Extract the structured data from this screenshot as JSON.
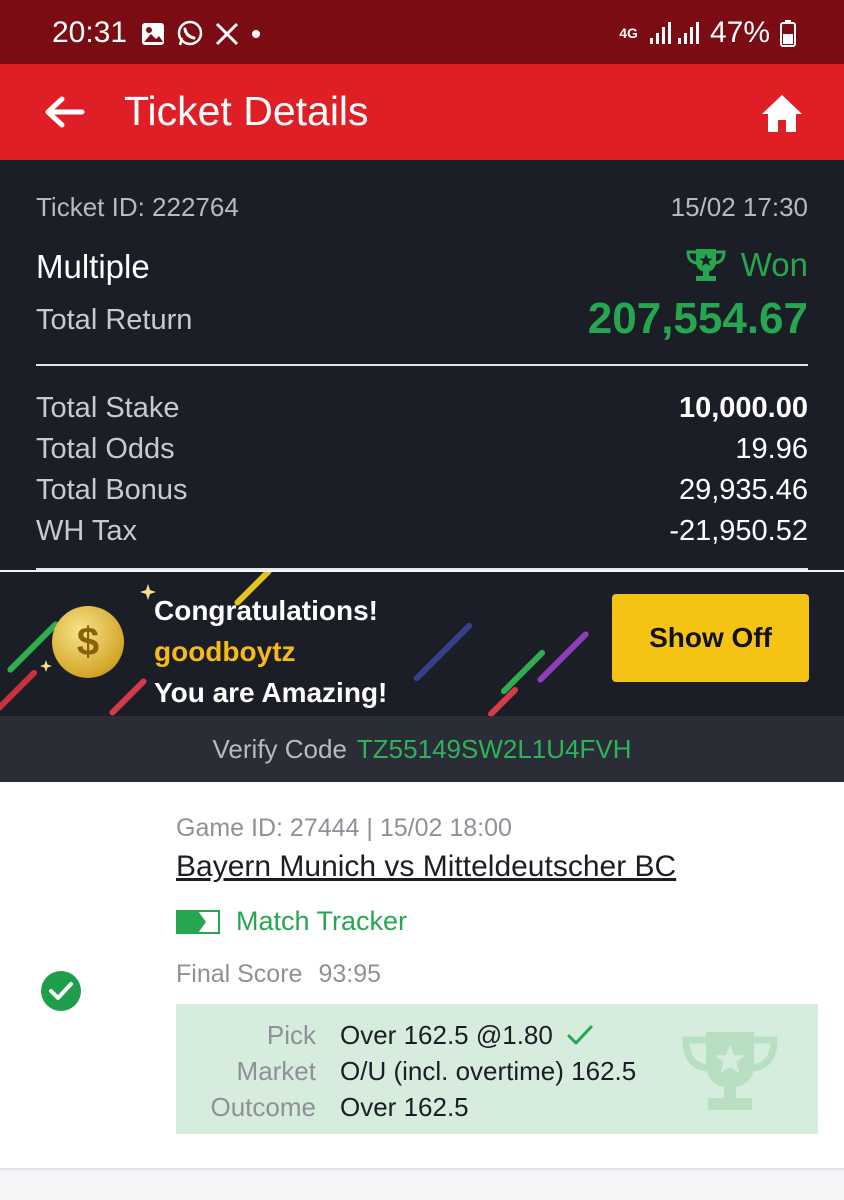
{
  "status_bar": {
    "time": "20:31",
    "network": "4G",
    "battery": "47%",
    "icons": [
      "gallery-icon",
      "whatsapp-icon",
      "x-icon",
      "dot-icon",
      "signal-icon",
      "battery-icon"
    ]
  },
  "header": {
    "title": "Ticket Details",
    "back_icon": "back-arrow-icon",
    "home_icon": "home-icon",
    "color": "#e01e26"
  },
  "ticket": {
    "id_label": "Ticket ID: 222764",
    "date": "15/02 17:30",
    "type": "Multiple",
    "status": "Won",
    "return_label": "Total Return",
    "return_value": "207,554.67",
    "rows": [
      {
        "label": "Total Stake",
        "value": "10,000.00"
      },
      {
        "label": "Total Odds",
        "value": "19.96"
      },
      {
        "label": "Total Bonus",
        "value": "29,935.46"
      },
      {
        "label": "WH Tax",
        "value": "-21,950.52"
      }
    ]
  },
  "banner": {
    "line1": "Congratulations!",
    "username": "goodboytz",
    "line3": "You are Amazing!",
    "button": "Show Off",
    "coin_symbol": "$"
  },
  "verify": {
    "label": "Verify Code",
    "code": "TZ55149SW2L1U4FVH"
  },
  "selection": {
    "game_id": "Game ID: 27444 | 15/02 18:00",
    "match": "Bayern Munich vs Mitteldeutscher BC",
    "tracker": "Match Tracker",
    "final_score_label": "Final Score",
    "final_score": "93:95",
    "pick_label": "Pick",
    "pick_value": "Over 162.5 @1.80",
    "market_label": "Market",
    "market_value": "O/U (incl. overtime) 162.5",
    "outcome_label": "Outcome",
    "outcome_value": "Over 162.5"
  },
  "colors": {
    "win_green": "#26a650",
    "dark_bg": "#1b1e26",
    "button_yellow": "#f5c314"
  }
}
